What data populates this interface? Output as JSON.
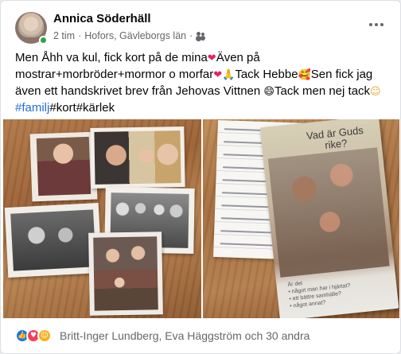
{
  "post": {
    "author": "Annica Söderhäll",
    "time": "2 tim",
    "location": "Hofors, Gävleborgs län",
    "text": {
      "segment1": "Men Åhh va kul, fick kort på de mina",
      "segment2": "Även på mostrar+morbröder+mormor o morfar",
      "segment3": "Tack Hebbe",
      "segment4": "Sen fick jag även ett handskrivet brev från Jehovas Vittnen ",
      "segment5": "Tack men nej tack",
      "hashtag1": "#familj",
      "hashtag2": "#kort",
      "hashtag3": "#kärlek"
    },
    "emojis": {
      "heart": "❤",
      "pray": "🙏",
      "smile_hearts": "🥰",
      "grin": "😄",
      "relieved": "☺"
    },
    "tract_title": "Vad är Guds rike?",
    "tract_small": "Är det\n• något man har i hjärtat?\n• ett bättre samhälle?\n• något annat?"
  },
  "reactions": {
    "names": "Britt-Inger Lundberg, Eva Häggström och 30 andra",
    "icons": [
      "like-icon",
      "love-icon",
      "care-icon"
    ]
  },
  "colors": {
    "link": "#216fdb",
    "secondary_text": "#65676b",
    "online": "#31a24c",
    "like": "#1877f2",
    "love": "#f33e58",
    "care": "#f7b125"
  }
}
